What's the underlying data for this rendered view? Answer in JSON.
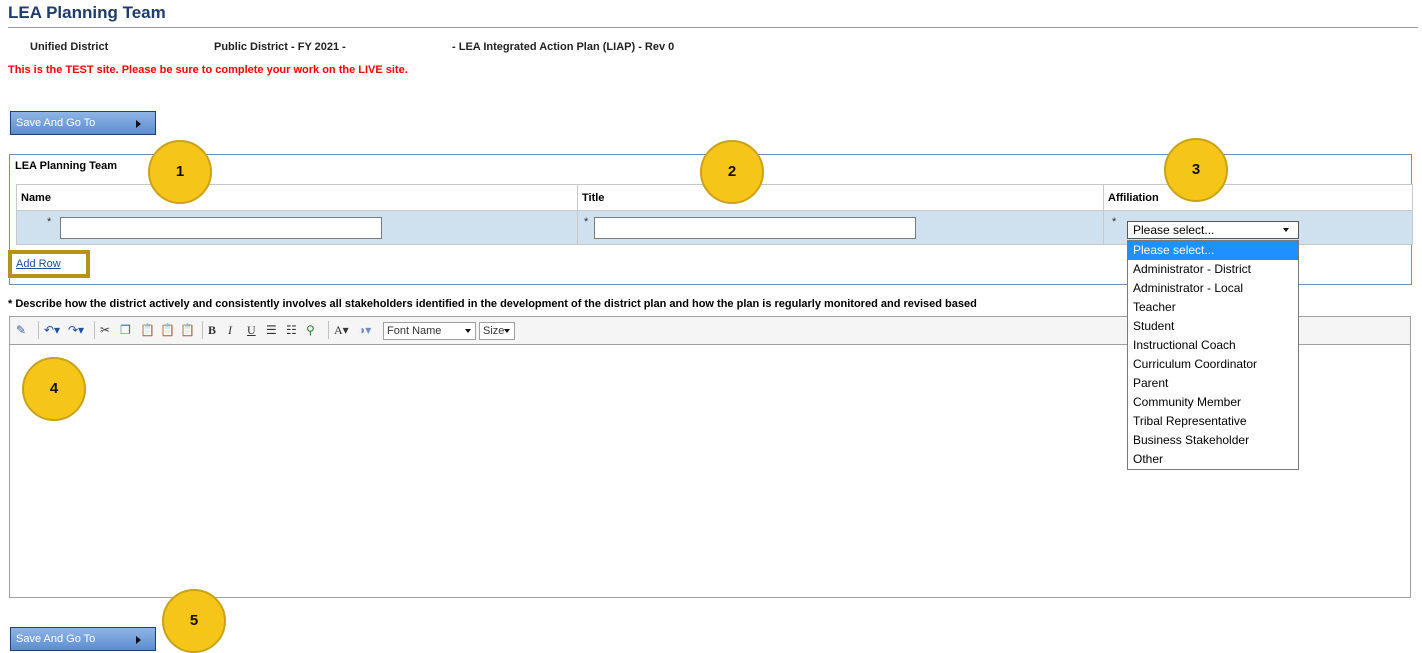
{
  "page": {
    "title": "LEA Planning Team",
    "district_name": "Unified District",
    "district_type": "Public District - FY 2021 -",
    "plan_name": "- LEA Integrated Action Plan (LIAP) - Rev 0",
    "test_warning": "This is the TEST site. Please be sure to complete your work on the LIVE site."
  },
  "buttons": {
    "save_and_go_to": "Save And Go To"
  },
  "team_panel": {
    "heading": "LEA Planning Team",
    "columns": [
      "Name",
      "Title",
      "Affiliation"
    ],
    "required_marker": "*",
    "name_value": "",
    "title_value": "",
    "affiliation_selected": "Please select...",
    "add_row_label": "Add Row"
  },
  "affiliation_options": [
    "Please select...",
    "Administrator - District",
    "Administrator - Local",
    "Teacher",
    "Student",
    "Instructional Coach",
    "Curriculum Coordinator",
    "Parent",
    "Community Member",
    "Tribal Representative",
    "Business Stakeholder",
    "Other"
  ],
  "stakeholder_prompt": "* Describe how the district actively and consistently involves all stakeholders identified in the development of the district plan and how the plan is regularly monitored and revised based",
  "editor": {
    "font_name_label": "Font Name",
    "size_label": "Size",
    "content": ""
  },
  "callouts": [
    "1",
    "2",
    "3",
    "4",
    "5"
  ],
  "colors": {
    "title": "#1f3c6b",
    "warning": "#ff0000",
    "callout": "#f5c518",
    "row_bg": "#cfe0ef",
    "selected_option": "#1e90ff"
  }
}
